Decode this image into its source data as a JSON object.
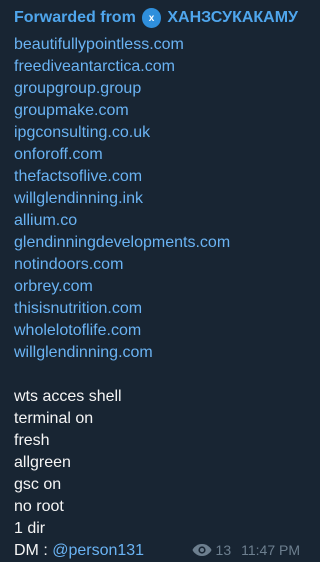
{
  "forward": {
    "prefix": "Forwarded from",
    "avatar_letter": "x",
    "channel": "ХАНЗСУКАКАМУ"
  },
  "links": [
    "beautifullypointless.com",
    "freediveantarctica.com",
    "groupgroup.group",
    "groupmake.com",
    "ipgconsulting.co.uk",
    "onforoff.com",
    "thefactsoflive.com",
    "willglendinning.ink",
    "allium.co",
    "glendinningdevelopments.com",
    "notindoors.com",
    "orbrey.com",
    "thisisnutrition.com",
    "wholelotoflife.com",
    "willglendinning.com"
  ],
  "details": [
    "wts acces shell",
    "terminal on",
    "fresh",
    "allgreen",
    "gsc on",
    "no root",
    "1 dir"
  ],
  "contact": {
    "label": "DM : ",
    "mention": "@person131"
  },
  "meta": {
    "views": "13",
    "time": "11:47 PM"
  },
  "colors": {
    "background": "#182533",
    "link": "#6ab3f3",
    "text": "#f5f5f5",
    "forward_header": "#4fa6ed",
    "meta": "#6d7f8f"
  },
  "icons": {
    "views": "eye-icon"
  }
}
